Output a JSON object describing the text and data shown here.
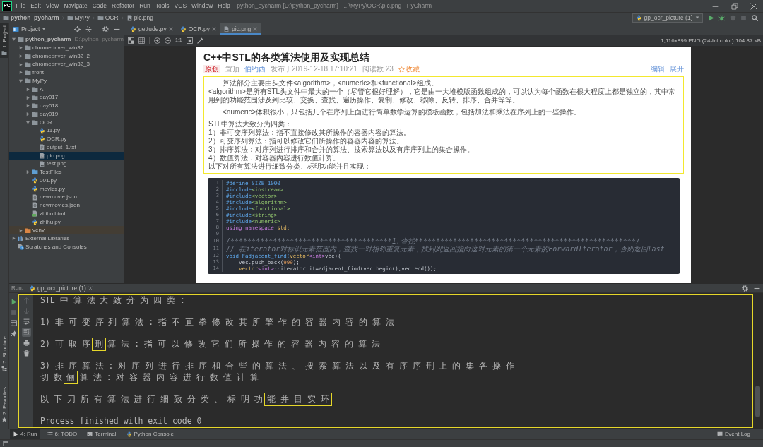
{
  "window": {
    "logo": "PC",
    "title": "python_pycharm [D:\\python_pycharm] - ...\\MyPy\\OCR\\pic.png - PyCharm"
  },
  "menu": [
    "File",
    "Edit",
    "View",
    "Navigate",
    "Code",
    "Refactor",
    "Run",
    "Tools",
    "VCS",
    "Window",
    "Help"
  ],
  "breadcrumbs": [
    {
      "label": "python_pycharm",
      "kind": "root"
    },
    {
      "label": "MyPy",
      "kind": "folder"
    },
    {
      "label": "OCR",
      "kind": "folder"
    },
    {
      "label": "pic.png",
      "kind": "image"
    }
  ],
  "run_config": {
    "label": "gp_ocr_picture (1)"
  },
  "run_actions": [
    {
      "kind": "run",
      "disabled": false
    },
    {
      "kind": "debug",
      "disabled": false
    },
    {
      "kind": "coverage",
      "disabled": true
    },
    {
      "kind": "stop",
      "disabled": true
    },
    {
      "kind": "search",
      "disabled": false
    }
  ],
  "left_strip": {
    "top": [
      {
        "label": "1: Project",
        "kind": "project",
        "selected": true
      }
    ],
    "bottom": [
      {
        "label": "7: Structure",
        "kind": "structure",
        "selected": false
      },
      {
        "label": "2: Favorites",
        "kind": "favorites",
        "selected": false
      }
    ]
  },
  "project_panel": {
    "title": "Project",
    "tree": [
      {
        "label": "python_pycharm",
        "hint": "D:\\python_pycharm",
        "kind": "root",
        "expanded": true,
        "selected": false,
        "children": [
          {
            "label": "chromedriver_win32",
            "kind": "folder",
            "expanded": false,
            "selected": false
          },
          {
            "label": "chromedriver_win32_2",
            "kind": "folder",
            "expanded": false,
            "selected": false
          },
          {
            "label": "chromedriver_win32_3",
            "kind": "folder",
            "expanded": false,
            "selected": false
          },
          {
            "label": "front",
            "kind": "folder",
            "expanded": false,
            "selected": false
          },
          {
            "label": "MyPy",
            "kind": "folder",
            "expanded": true,
            "selected": false,
            "children": [
              {
                "label": "A",
                "kind": "folder",
                "expanded": false,
                "selected": false
              },
              {
                "label": "day017",
                "kind": "folder",
                "expanded": false,
                "selected": false
              },
              {
                "label": "day018",
                "kind": "folder",
                "expanded": false,
                "selected": false
              },
              {
                "label": "day019",
                "kind": "folder",
                "expanded": false,
                "selected": false
              },
              {
                "label": "OCR",
                "kind": "folder",
                "expanded": true,
                "selected": false,
                "children": [
                  {
                    "label": "11.py",
                    "kind": "python",
                    "selected": false
                  },
                  {
                    "label": "OCR.py",
                    "kind": "python",
                    "selected": false
                  },
                  {
                    "label": "output_1.txt",
                    "kind": "text",
                    "selected": false
                  },
                  {
                    "label": "pic.png",
                    "kind": "image",
                    "selected": true
                  },
                  {
                    "label": "test.png",
                    "kind": "image",
                    "selected": false
                  }
                ]
              },
              {
                "label": "TestFiles",
                "kind": "test-folder",
                "expanded": false,
                "selected": false
              },
              {
                "label": "001.py",
                "kind": "python",
                "selected": false
              },
              {
                "label": "movies.py",
                "kind": "python",
                "selected": false
              },
              {
                "label": "newmovie.json",
                "kind": "json",
                "selected": false
              },
              {
                "label": "newmovies.json",
                "kind": "json",
                "selected": false
              },
              {
                "label": "zhihu.html",
                "kind": "html",
                "selected": false
              },
              {
                "label": "zhihu.py",
                "kind": "python",
                "selected": false
              }
            ]
          },
          {
            "label": "venv",
            "kind": "excluded-folder",
            "expanded": false,
            "selected": false
          }
        ]
      },
      {
        "label": "External Libraries",
        "kind": "libraries",
        "expanded": false,
        "selected": false
      },
      {
        "label": "Scratches and Consoles",
        "kind": "scratches",
        "selected": false
      }
    ]
  },
  "editor_tabs": [
    {
      "label": "gettude.py",
      "kind": "python",
      "selected": false
    },
    {
      "label": "OCR.py",
      "kind": "python",
      "selected": false
    },
    {
      "label": "pic.png",
      "kind": "image",
      "selected": true
    }
  ],
  "image_viewer": {
    "zoom_label": "1:1",
    "info": "1,116x899 PNG (24-bit color) 104.87 kB",
    "document": {
      "title": "C++中STL的各类算法使用及实现总结",
      "meta": [
        {
          "kind": "tag",
          "text": "原创"
        },
        {
          "kind": "text",
          "text": "置顶"
        },
        {
          "kind": "author",
          "text": "伯约西"
        },
        {
          "kind": "text",
          "text": "发布于2019-12-18 17:10:21"
        },
        {
          "kind": "text",
          "text": "阅读数 23"
        },
        {
          "kind": "favorite",
          "text": "收藏"
        }
      ],
      "actions": [
        "编辑",
        "展开"
      ],
      "summary": {
        "outlined": true,
        "blocks": [
          [
            {
              "kind": "indented",
              "text": "算法部分主要由头文件<algorithm>，<numeric>和<functional>组成。"
            },
            {
              "kind": "plain",
              "text": "<algorithm>是所有STL头文件中最大的一个（尽管它很好理解），它是由一大堆模版函数组成的，可以认为每个函数在很大程度上都是独立的，其中常用到的功能范围涉及到比较、交换、查找、遍历操作、复制、修改、移除、反转、排序、合并等等。"
            }
          ],
          [
            {
              "kind": "indented",
              "text": "<numeric>体积很小，只包括几个在序列上面进行简单数学运算的模板函数，包括加法和乘法在序列上的一些操作。"
            }
          ],
          [
            {
              "kind": "plain",
              "text": "STL中算法大致分为四类："
            },
            {
              "kind": "plain",
              "text": "1）非可变序列算法：指不直接修改其所操作的容器内容的算法。"
            },
            {
              "kind": "plain",
              "text": "2）可变序列算法：指可以修改它们所操作的容器内容的算法。"
            },
            {
              "kind": "plain",
              "text": "3）排序算法：对序列进行排序和合并的算法、搜索算法以及有序序列上的集合操作。"
            },
            {
              "kind": "plain",
              "text": "4）数值算法：对容器内容进行数值计算。"
            },
            {
              "kind": "plain",
              "text": "以下对所有算法进行细致分类、标明功能并且实现："
            }
          ]
        ]
      },
      "code": [
        {
          "number": "1",
          "tokens": [
            {
              "kind": "macro",
              "text": "#define SIZE 1000"
            }
          ]
        },
        {
          "number": "2",
          "tokens": [
            {
              "kind": "macro",
              "text": "#include"
            },
            {
              "kind": "header",
              "text": "<iostream>"
            }
          ]
        },
        {
          "number": "3",
          "tokens": [
            {
              "kind": "macro",
              "text": "#include"
            },
            {
              "kind": "header",
              "text": "<vector>"
            }
          ]
        },
        {
          "number": "4",
          "tokens": [
            {
              "kind": "macro",
              "text": "#include"
            },
            {
              "kind": "header",
              "text": "<algorithm>"
            }
          ]
        },
        {
          "number": "5",
          "tokens": [
            {
              "kind": "macro",
              "text": "#include"
            },
            {
              "kind": "header",
              "text": "<functional>"
            }
          ]
        },
        {
          "number": "6",
          "tokens": [
            {
              "kind": "macro",
              "text": "#include"
            },
            {
              "kind": "header",
              "text": "<string>"
            }
          ]
        },
        {
          "number": "7",
          "tokens": [
            {
              "kind": "macro",
              "text": "#include"
            },
            {
              "kind": "header",
              "text": "<numeric>"
            }
          ]
        },
        {
          "number": "8",
          "tokens": [
            {
              "kind": "keyword",
              "text": "using namespace "
            },
            {
              "kind": "type",
              "text": "std;"
            }
          ]
        },
        {
          "number": "9"
        },
        {
          "number": "10",
          "tokens": [
            {
              "kind": "comment",
              "text": "/**************************************1.查找****************************************************/"
            }
          ]
        },
        {
          "number": "11",
          "tokens": [
            {
              "kind": "comment",
              "text": "// 在iterator对标识元素范围内，查找一对相邻重复元素，找到则返回指向这对元素的第一个元素的ForwardIterator，否则返回last"
            }
          ]
        },
        {
          "number": "12",
          "tokens": [
            {
              "kind": "function",
              "text": "void Fadjacent_find("
            },
            {
              "kind": "type",
              "text": "vector"
            },
            {
              "kind": "keyword",
              "text": "<int>"
            },
            {
              "kind": "plain",
              "text": "vec){"
            }
          ]
        },
        {
          "number": "13",
          "tokens": [
            {
              "kind": "plain",
              "text": "    vec.push_back("
            },
            {
              "kind": "number",
              "text": "999"
            },
            {
              "kind": "plain",
              "text": ");"
            }
          ]
        },
        {
          "number": "14",
          "tokens": [
            {
              "kind": "type",
              "text": "    vector"
            },
            {
              "kind": "keyword",
              "text": "<int>"
            },
            {
              "kind": "plain",
              "text": "::iterator it=adjacent_find(vec.begin(),vec.end());"
            }
          ]
        }
      ]
    }
  },
  "run_panel": {
    "title": "Run:",
    "tab": "gp_ocr_picture (1)",
    "side_tools": [
      {
        "kind": "rerun",
        "disabled": false
      },
      {
        "kind": "stop",
        "disabled": true
      },
      {
        "kind": "layout",
        "disabled": false
      },
      {
        "kind": "pin",
        "disabled": false
      }
    ],
    "console_tools": [
      {
        "kind": "up",
        "disabled": true,
        "selected": false
      },
      {
        "kind": "down",
        "disabled": true,
        "selected": false
      },
      {
        "kind": "soft-wrap",
        "disabled": false,
        "selected": false
      },
      {
        "kind": "scroll-end",
        "disabled": false,
        "selected": true
      },
      {
        "kind": "print",
        "disabled": false,
        "selected": false
      },
      {
        "kind": "trash",
        "disabled": false,
        "selected": false
      }
    ],
    "console": {
      "outlined": true,
      "blocks": [
        {
          "lines": [
            {
              "segments": [
                {
                  "text": "STL 中 算 法 大 致 分 为 四 类 :",
                  "boxed": false
                }
              ]
            }
          ]
        },
        {
          "lines": [
            {
              "segments": [
                {
                  "text": "1) 非 可 变 序 列 算 法 : 指 不 直 拳 修 改 其 所 擎 作 的 容 器 内 容 的 算 法",
                  "boxed": false
                }
              ]
            }
          ]
        },
        {
          "lines": [
            {
              "segments": [
                {
                  "text": "2) 可 取 序 ",
                  "boxed": false
                },
                {
                  "text": "刑",
                  "boxed": true
                },
                {
                  "text": " 算 法 : 指 可 以 修 改 它 们 所 操 作 的 容 器 内 容 的 算 法",
                  "boxed": false
                }
              ]
            }
          ]
        },
        {
          "lines": [
            {
              "segments": [
                {
                  "text": "3) 排 序 算 法 : 对 序 列 进 行 排 序 和 合 些 的 算 法 、 搜 索 算 法 以 及 有 序 序 刑 上 的 集 各 操 作",
                  "boxed": false
                }
              ]
            },
            {
              "segments": [
                {
                  "text": "切 数 ",
                  "boxed": false
                },
                {
                  "text": "俪",
                  "boxed": true
                },
                {
                  "text": " 算 法 : 对 容 器 内 容 进 行 数 值 计 算",
                  "boxed": false
                }
              ]
            }
          ]
        },
        {
          "lines": [
            {
              "segments": [
                {
                  "text": "以 下 刀 所 有 算 法 进 行 细 致 分 类 、 标 明 功 ",
                  "boxed": false
                },
                {
                  "text": "能 并 目 实 环",
                  "boxed": true
                }
              ]
            }
          ]
        },
        {
          "lines": [
            {
              "segments": [
                {
                  "text": "Process finished with exit code 0",
                  "boxed": false
                }
              ]
            }
          ]
        }
      ]
    }
  },
  "tool_buttons": {
    "left": [
      {
        "label": "4: Run",
        "kind": "run",
        "selected": true
      },
      {
        "label": "6: TODO",
        "kind": "todo",
        "selected": false
      },
      {
        "label": "Terminal",
        "kind": "terminal",
        "selected": false
      },
      {
        "label": "Python Console",
        "kind": "python-console",
        "selected": false
      }
    ],
    "right": [
      {
        "label": "Event Log",
        "kind": "event-log",
        "selected": false
      }
    ]
  }
}
